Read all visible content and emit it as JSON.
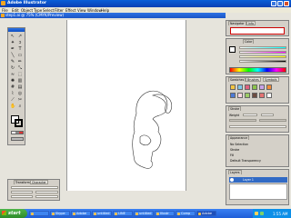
{
  "app": {
    "title": "Adobe Illustrator",
    "menu": [
      "File",
      "Edit",
      "Object",
      "Type",
      "Select",
      "Filter",
      "Effect",
      "View",
      "Window",
      "Help"
    ]
  },
  "document": {
    "title": "step1.ai @ 75% (CMYK/Preview)"
  },
  "panels": {
    "navigator": {
      "tabs": [
        "Navigator",
        "Info"
      ]
    },
    "color": {
      "tabs": [
        "Color"
      ]
    },
    "swatches": {
      "tabs": [
        "Swatches",
        "Brushes",
        "Symbols"
      ]
    },
    "stroke": {
      "tabs": [
        "Stroke"
      ],
      "weight_label": "Weight"
    },
    "appearance": {
      "tabs": [
        "Appearance"
      ],
      "items": [
        "No Selection",
        "Stroke",
        "Fill",
        "Default Transparency"
      ]
    },
    "layers": {
      "tabs": [
        "Layers"
      ],
      "layer_name": "Layer 1"
    },
    "character": {
      "tabs": [
        "Transform",
        "Character"
      ]
    }
  },
  "taskbar": {
    "start_label": "start",
    "buttons": [
      "",
      "Skype",
      "Adobe",
      "untitled",
      "LINE",
      "untitled",
      "Illustr",
      "Comp",
      "Adobe"
    ],
    "clock": "1:55 AM"
  },
  "colors": {
    "title_blue": "#0a3fb4",
    "taskbar_blue": "#245edb",
    "start_green": "#3c9e35",
    "panel_gray": "#d4d0c8"
  }
}
